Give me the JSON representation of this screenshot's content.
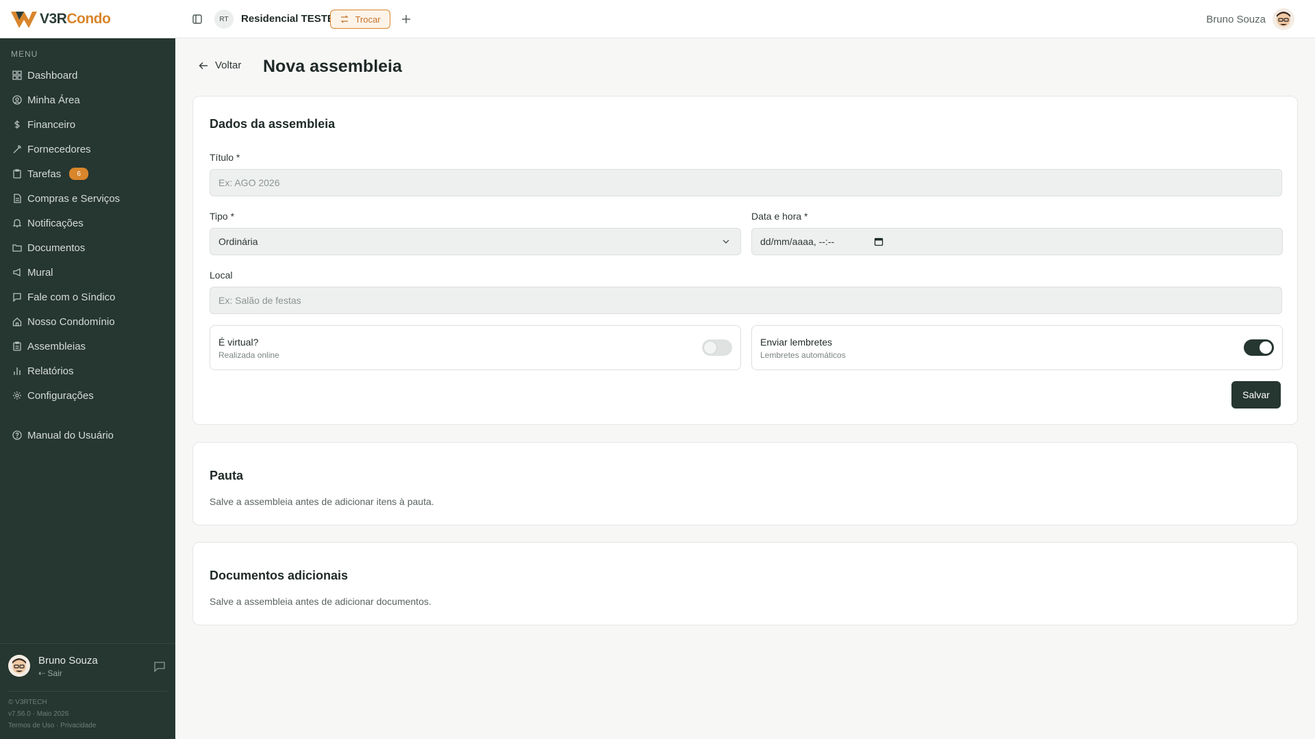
{
  "brand": {
    "logo_main": "V3R",
    "logo_accent": "Condo"
  },
  "topbar": {
    "condo_initials": "RT",
    "condo_name": "Residencial TESTE",
    "switch_label": "Trocar",
    "user_name": "Bruno Souza"
  },
  "sidebar": {
    "menu_label": "MENU",
    "items": [
      {
        "label": "Dashboard",
        "icon": "grid-icon"
      },
      {
        "label": "Minha Área",
        "icon": "user-circle-icon"
      },
      {
        "label": "Financeiro",
        "icon": "dollar-icon"
      },
      {
        "label": "Fornecedores",
        "icon": "wrench-icon"
      },
      {
        "label": "Tarefas",
        "icon": "clipboard-icon",
        "badge": "6"
      },
      {
        "label": "Compras e Serviços",
        "icon": "file-icon"
      },
      {
        "label": "Notificações",
        "icon": "bell-icon"
      },
      {
        "label": "Documentos",
        "icon": "folder-icon"
      },
      {
        "label": "Mural",
        "icon": "megaphone-icon"
      },
      {
        "label": "Fale com o Síndico",
        "icon": "message-icon"
      },
      {
        "label": "Nosso Condomínio",
        "icon": "home-icon"
      },
      {
        "label": "Assembleias",
        "icon": "clipboard-list-icon"
      },
      {
        "label": "Relatórios",
        "icon": "bar-chart-icon"
      },
      {
        "label": "Configurações",
        "icon": "gear-icon"
      }
    ],
    "manual": {
      "label": "Manual do Usuário",
      "icon": "help-circle-icon"
    },
    "user": {
      "name": "Bruno Souza",
      "logout": "Sair"
    },
    "footer": {
      "copyright": "© V3RTECH",
      "version": "v7.56.0 · Maio 2026",
      "terms": "Termos de Uso",
      "separator": "·",
      "privacy": "Privacidade"
    }
  },
  "page": {
    "back_label": "Voltar",
    "title": "Nova assembleia"
  },
  "form": {
    "section_title": "Dados da assembleia",
    "title_label": "Título *",
    "title_placeholder": "Ex: AGO 2026",
    "type_label": "Tipo *",
    "type_value": "Ordinária",
    "datetime_label": "Data e hora *",
    "datetime_value": "dd/mm/aaaa, --:--",
    "local_label": "Local",
    "local_placeholder": "Ex: Salão de festas",
    "virtual": {
      "title": "É virtual?",
      "subtitle": "Realizada online",
      "enabled": false
    },
    "reminders": {
      "title": "Enviar lembretes",
      "subtitle": "Lembretes automáticos",
      "enabled": true
    },
    "save_label": "Salvar"
  },
  "agenda": {
    "title": "Pauta",
    "message": "Salve a assembleia antes de adicionar itens à pauta."
  },
  "documents": {
    "title": "Documentos adicionais",
    "message": "Salve a assembleia antes de adicionar documentos."
  }
}
